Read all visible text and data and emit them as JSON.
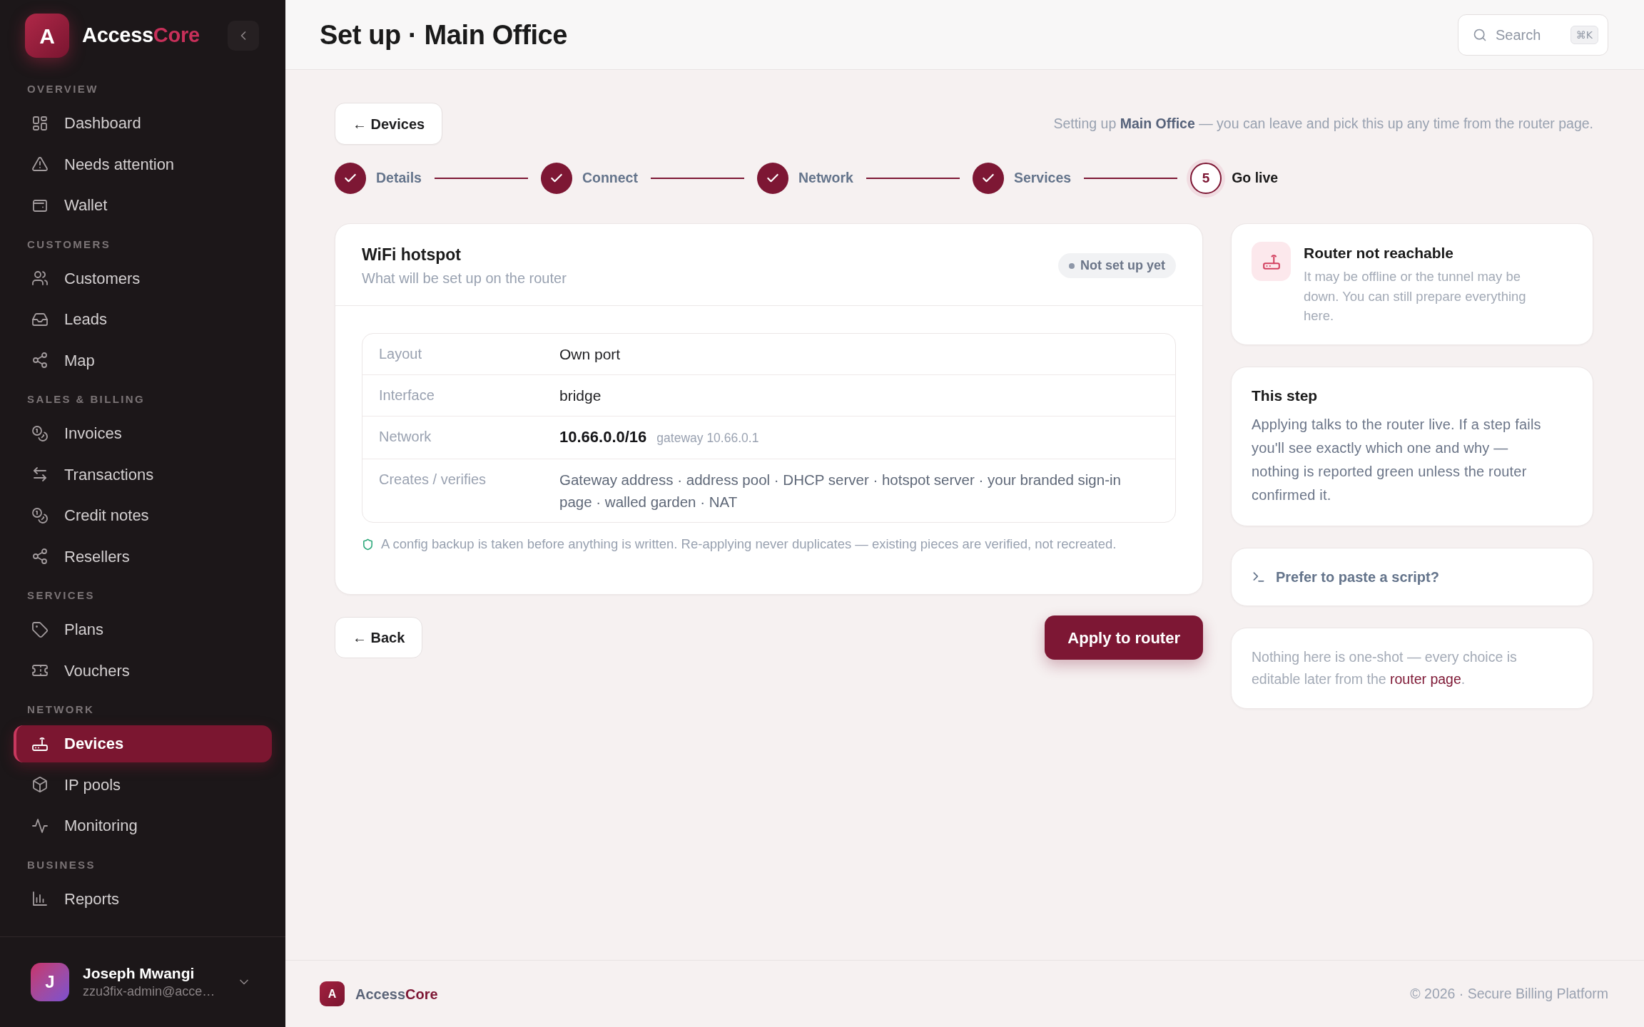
{
  "sidebar": {
    "brand": {
      "logo_letter": "A",
      "name": "Access",
      "name_accent": "Core"
    },
    "sections": [
      {
        "title": "OVERVIEW",
        "items": [
          {
            "label": "Dashboard",
            "selected": false
          },
          {
            "label": "Needs attention",
            "selected": false
          },
          {
            "label": "Wallet",
            "selected": false
          }
        ]
      },
      {
        "title": "CUSTOMERS",
        "items": [
          {
            "label": "Customers",
            "selected": false
          },
          {
            "label": "Leads",
            "selected": false
          },
          {
            "label": "Map",
            "selected": false
          }
        ]
      },
      {
        "title": "SALES & BILLING",
        "items": [
          {
            "label": "Invoices",
            "selected": false
          },
          {
            "label": "Transactions",
            "selected": false
          },
          {
            "label": "Credit notes",
            "selected": false
          },
          {
            "label": "Resellers",
            "selected": false
          }
        ]
      },
      {
        "title": "SERVICES",
        "items": [
          {
            "label": "Plans",
            "selected": false
          },
          {
            "label": "Vouchers",
            "selected": false
          }
        ]
      },
      {
        "title": "NETWORK",
        "items": [
          {
            "label": "Devices",
            "selected": true
          },
          {
            "label": "IP pools",
            "selected": false
          },
          {
            "label": "Monitoring",
            "selected": false
          }
        ]
      },
      {
        "title": "BUSINESS",
        "items": [
          {
            "label": "Reports",
            "selected": false
          }
        ]
      }
    ],
    "user": {
      "initial": "J",
      "name": "Joseph Mwangi",
      "email": "zzu3fix-admin@acce…"
    }
  },
  "header": {
    "title": "Set up · Main Office",
    "search": {
      "placeholder": "Search",
      "shortcut": "⌘K"
    }
  },
  "back_link": "← Devices",
  "progress_note": "Setting up **Main Office** — you can leave and pick this up any time from the router page.",
  "steps": [
    {
      "label": "Details",
      "completed": true,
      "current": false
    },
    {
      "label": "Connect",
      "completed": true,
      "current": false
    },
    {
      "label": "Network",
      "completed": true,
      "current": false
    },
    {
      "label": "Services",
      "completed": true,
      "current": false
    },
    {
      "label": "Go live",
      "completed": false,
      "current": true,
      "number": "5"
    }
  ],
  "card": {
    "title": "WiFi hotspot",
    "subtitle": "What will be set up on the router",
    "status": "Not set up yet",
    "details": [
      {
        "kind": "text",
        "label": "Layout",
        "value": "Own port"
      },
      {
        "kind": "text",
        "label": "Interface",
        "value": "bridge"
      },
      {
        "kind": "address",
        "label": "Network",
        "value": "10.66.0.0/16",
        "note": "gateway 10.66.0.1"
      },
      {
        "kind": "list",
        "label": "Creates / verifies",
        "value": "Gateway address · address pool · DHCP server · hotspot server · your branded sign-in page · walled garden · NAT"
      }
    ],
    "backup_note": "A config backup is taken before anything is written. Re-applying never duplicates — existing pieces are verified, not recreated."
  },
  "actions": {
    "back": "← Back",
    "apply": "Apply to router"
  },
  "side_cards": [
    {
      "kind": "alert",
      "title": "Router not reachable",
      "text": "It may be offline or the tunnel may be down. You can still prepare everything here."
    },
    {
      "kind": "info",
      "title": "This step",
      "text": "Applying talks to the router live. If a step fails you'll see exactly which one and why — nothing is reported green unless the router confirmed it."
    },
    {
      "kind": "link",
      "label": "Prefer to paste a script?"
    },
    {
      "kind": "note",
      "text": "Nothing here is one-shot — every choice is editable later from the ",
      "link": "router page",
      "text_after": "."
    }
  ],
  "footer": {
    "logo_letter": "A",
    "name": "Access",
    "name_accent": "Core",
    "copyright": "© 2026 · Secure Billing Platform"
  }
}
